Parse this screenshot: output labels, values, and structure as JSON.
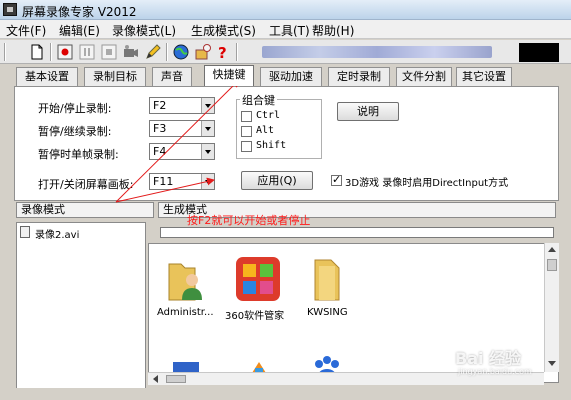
{
  "window": {
    "title": "屏幕录像专家 V2012"
  },
  "menu": [
    {
      "label": "文件(F)"
    },
    {
      "label": "编辑(E)"
    },
    {
      "label": "录像模式(L)"
    },
    {
      "label": "生成模式(S)"
    },
    {
      "label": "工具(T)"
    },
    {
      "label": "帮助(H)"
    }
  ],
  "toolbar": {
    "icons": [
      "new-file-icon",
      "record-icon",
      "pause-icon",
      "stop-icon",
      "camera-icon",
      "pen-icon",
      "globe-icon",
      "settings-icon",
      "help-icon"
    ]
  },
  "tabs": [
    {
      "label": "基本设置"
    },
    {
      "label": "录制目标"
    },
    {
      "label": "声音"
    },
    {
      "label": "快捷键",
      "active": true
    },
    {
      "label": "驱动加速"
    },
    {
      "label": "定时录制"
    },
    {
      "label": "文件分割"
    },
    {
      "label": "其它设置"
    }
  ],
  "hotkeys": [
    {
      "label": "开始/停止录制:",
      "value": "F2"
    },
    {
      "label": "暂停/继续录制:",
      "value": "F3"
    },
    {
      "label": "暂停时单帧录制:",
      "value": "F4"
    },
    {
      "label": "打开/关闭屏幕画板:",
      "value": "F11"
    }
  ],
  "combo": {
    "title": "组合键",
    "options": [
      {
        "label": "Ctrl",
        "checked": false
      },
      {
        "label": "Alt",
        "checked": false
      },
      {
        "label": "Shift",
        "checked": false
      }
    ]
  },
  "buttons": {
    "explain": "说明",
    "apply": "应用(Q)"
  },
  "direct_input": {
    "label": "3D游戏 录像时启用DirectInput方式",
    "checked": true
  },
  "lower_tabs": {
    "record_mode": "录像模式",
    "generate_mode": "生成模式"
  },
  "annotation": {
    "hint": "按F2就可以开始或者停止"
  },
  "file_list": [
    {
      "name": "录像2.avi"
    }
  ],
  "desktop": [
    {
      "label": "Administr...",
      "icon": "user-folder-icon"
    },
    {
      "label": "360软件管家",
      "icon": "app-tile-icon"
    },
    {
      "label": "KWSING",
      "icon": "folder-icon"
    }
  ],
  "watermark": {
    "main": "Bai 经验",
    "sub": "jingyan.baidu.com"
  },
  "colors": {
    "annotation": "#ff1a1a",
    "active_tab": "#ffffff",
    "panel_bg": "#d4d0c8"
  }
}
